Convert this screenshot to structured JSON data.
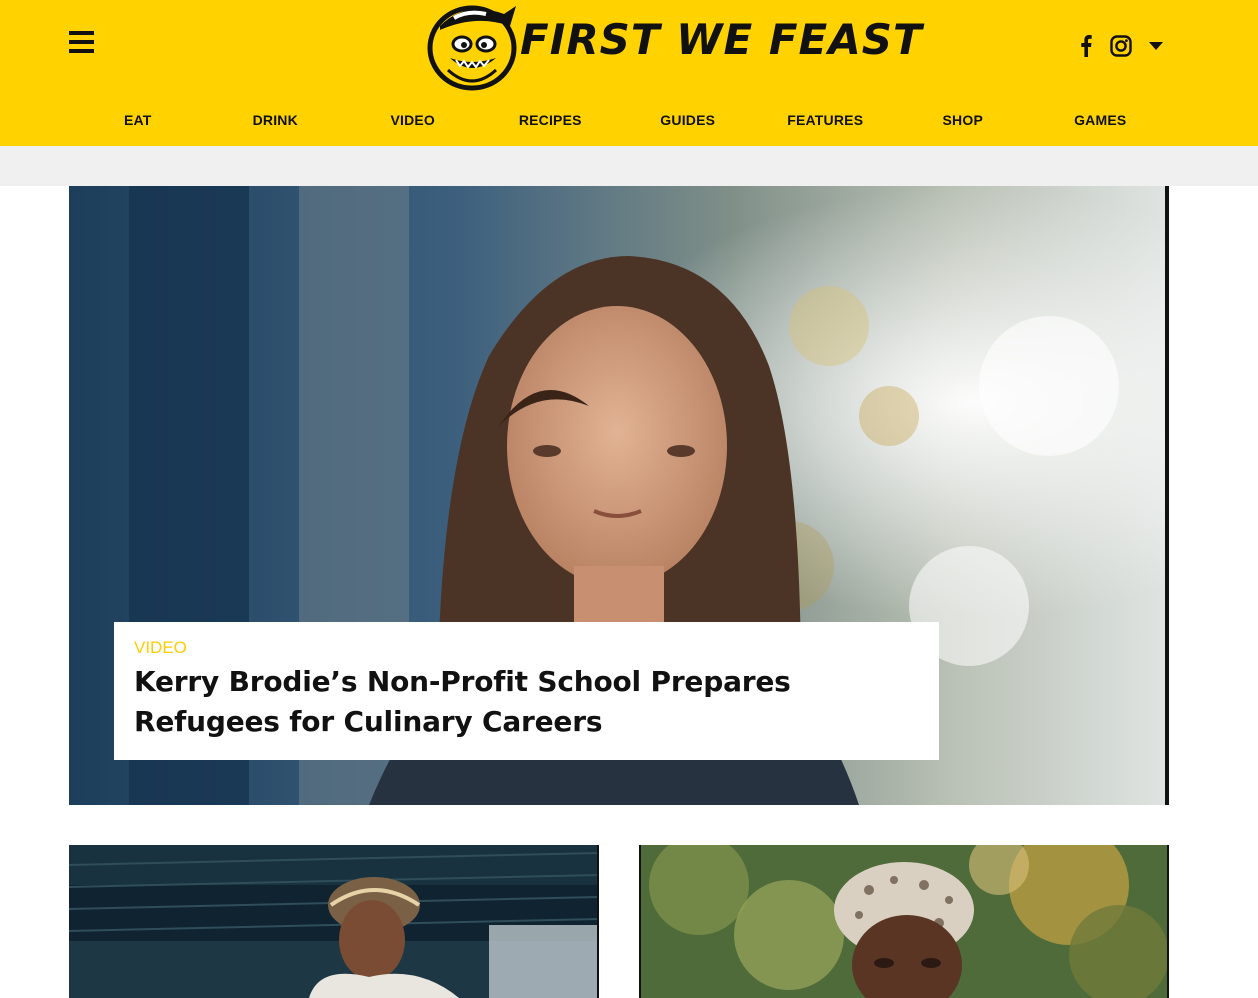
{
  "header": {
    "site_name": "FIRST WE FEAST",
    "menu_icon": "hamburger-menu-icon",
    "social": [
      {
        "name": "facebook-icon"
      },
      {
        "name": "instagram-icon"
      },
      {
        "name": "caret-down-icon"
      }
    ],
    "nav": [
      "EAT",
      "DRINK",
      "VIDEO",
      "RECIPES",
      "GUIDES",
      "FEATURES",
      "SHOP",
      "GAMES"
    ]
  },
  "hero": {
    "kicker": "VIDEO",
    "title": "Kerry Brodie’s Non-Profit School Prepares Refugees for Culinary Careers"
  },
  "colors": {
    "brand_yellow": "#ffd200",
    "kicker_yellow": "#ffcc00",
    "band_gray": "#f0f0f0",
    "text_dark": "#111111"
  }
}
